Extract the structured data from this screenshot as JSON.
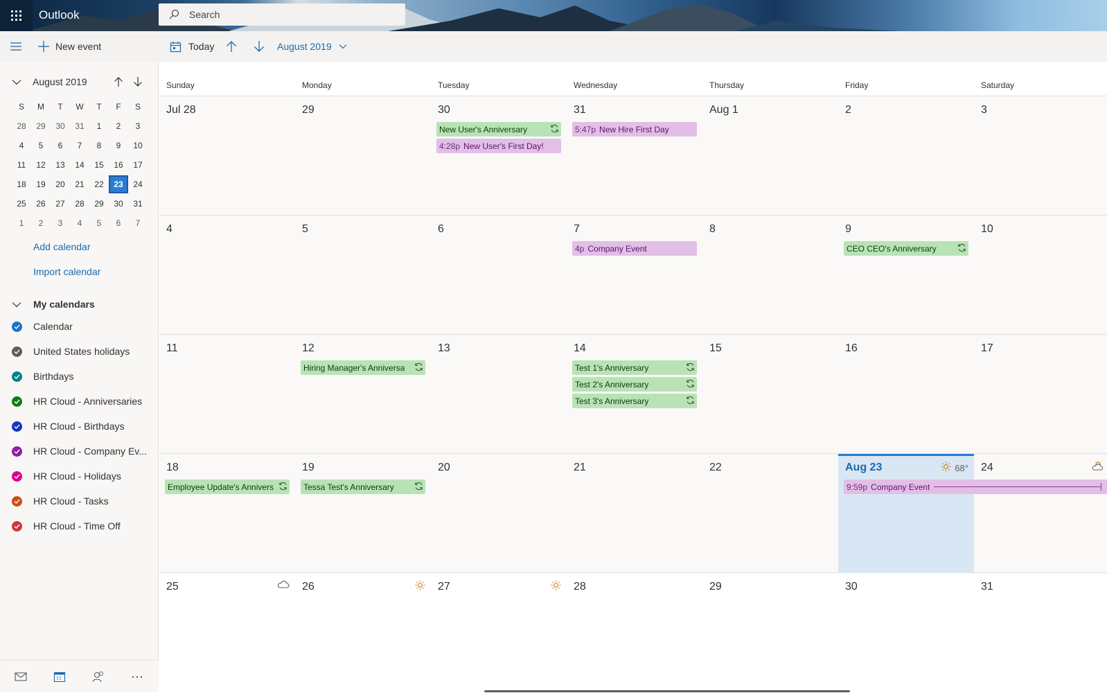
{
  "header": {
    "app_name": "Outlook",
    "search_placeholder": "Search"
  },
  "toolbar": {
    "new_event": "New event",
    "today": "Today",
    "month_label": "August 2019"
  },
  "mini_calendar": {
    "title": "August 2019",
    "weekdays": [
      "S",
      "M",
      "T",
      "W",
      "T",
      "F",
      "S"
    ],
    "weeks": [
      [
        "28",
        "29",
        "30",
        "31",
        "1",
        "2",
        "3"
      ],
      [
        "4",
        "5",
        "6",
        "7",
        "8",
        "9",
        "10"
      ],
      [
        "11",
        "12",
        "13",
        "14",
        "15",
        "16",
        "17"
      ],
      [
        "18",
        "19",
        "20",
        "21",
        "22",
        "23",
        "24"
      ],
      [
        "25",
        "26",
        "27",
        "28",
        "29",
        "30",
        "31"
      ],
      [
        "1",
        "2",
        "3",
        "4",
        "5",
        "6",
        "7"
      ]
    ],
    "selected": "23"
  },
  "sidebar": {
    "add_calendar": "Add calendar",
    "import_calendar": "Import calendar",
    "my_calendars": "My calendars",
    "calendars": [
      {
        "name": "Calendar",
        "color": "#1a73c9"
      },
      {
        "name": "United States holidays",
        "color": "#605e5c"
      },
      {
        "name": "Birthdays",
        "color": "#038387"
      },
      {
        "name": "HR Cloud - Anniversaries",
        "color": "#107c10"
      },
      {
        "name": "HR Cloud - Birthdays",
        "color": "#1533c2"
      },
      {
        "name": "HR Cloud - Company Ev...",
        "color": "#8e1fa5"
      },
      {
        "name": "HR Cloud - Holidays",
        "color": "#e3008c"
      },
      {
        "name": "HR Cloud - Tasks",
        "color": "#ca5010"
      },
      {
        "name": "HR Cloud - Time Off",
        "color": "#d13438"
      }
    ]
  },
  "calendar": {
    "day_names": [
      "Sunday",
      "Monday",
      "Tuesday",
      "Wednesday",
      "Thursday",
      "Friday",
      "Saturday"
    ],
    "weeks": [
      [
        "Jul 28",
        "29",
        "30",
        "31",
        "Aug 1",
        "2",
        "3"
      ],
      [
        "4",
        "5",
        "6",
        "7",
        "8",
        "9",
        "10"
      ],
      [
        "11",
        "12",
        "13",
        "14",
        "15",
        "16",
        "17"
      ],
      [
        "18",
        "19",
        "20",
        "21",
        "22",
        "Aug 23",
        "24"
      ],
      [
        "25",
        "26",
        "27",
        "28",
        "29",
        "30",
        "31"
      ]
    ],
    "today_weather": "68°",
    "events": [
      {
        "week": 0,
        "day": 2,
        "slot": 0,
        "color": "green",
        "time": "",
        "title": "New User's Anniversary",
        "recurring": true
      },
      {
        "week": 0,
        "day": 2,
        "slot": 1,
        "color": "purple",
        "time": "4:28p",
        "title": "New User's First Day!",
        "recurring": false
      },
      {
        "week": 0,
        "day": 3,
        "slot": 0,
        "color": "purple",
        "time": "5:47p",
        "title": "New Hire First Day",
        "recurring": false
      },
      {
        "week": 1,
        "day": 3,
        "slot": 0,
        "color": "purple",
        "time": "4p",
        "title": "Company Event",
        "recurring": false
      },
      {
        "week": 1,
        "day": 5,
        "slot": 0,
        "color": "green",
        "time": "",
        "title": "CEO CEO's Anniversary",
        "recurring": true
      },
      {
        "week": 2,
        "day": 1,
        "slot": 0,
        "color": "green",
        "time": "",
        "title": "Hiring Manager's Anniversa",
        "recurring": true
      },
      {
        "week": 2,
        "day": 3,
        "slot": 0,
        "color": "green",
        "time": "",
        "title": "Test 1's Anniversary",
        "recurring": true
      },
      {
        "week": 2,
        "day": 3,
        "slot": 1,
        "color": "green",
        "time": "",
        "title": "Test 2's Anniversary",
        "recurring": true
      },
      {
        "week": 2,
        "day": 3,
        "slot": 2,
        "color": "green",
        "time": "",
        "title": "Test 3's Anniversary",
        "recurring": true
      },
      {
        "week": 3,
        "day": 0,
        "slot": 0,
        "color": "green",
        "time": "",
        "title": "Employee Update's Annivers",
        "recurring": true
      },
      {
        "week": 3,
        "day": 1,
        "slot": 0,
        "color": "green",
        "time": "",
        "title": "Tessa Test's Anniversary",
        "recurring": true
      },
      {
        "week": 3,
        "day": 5,
        "slot": 0,
        "span": 2,
        "color": "purple",
        "time": "9:59p",
        "title": "Company Event",
        "recurring": false
      }
    ],
    "weather_icons": [
      {
        "week": 3,
        "day": 5,
        "icon": "sun-icon"
      },
      {
        "week": 3,
        "day": 6,
        "icon": "partly-cloudy-icon"
      },
      {
        "week": 4,
        "day": 0,
        "icon": "cloud-icon"
      },
      {
        "week": 4,
        "day": 1,
        "icon": "sun-icon"
      },
      {
        "week": 4,
        "day": 2,
        "icon": "sun-icon"
      }
    ]
  }
}
